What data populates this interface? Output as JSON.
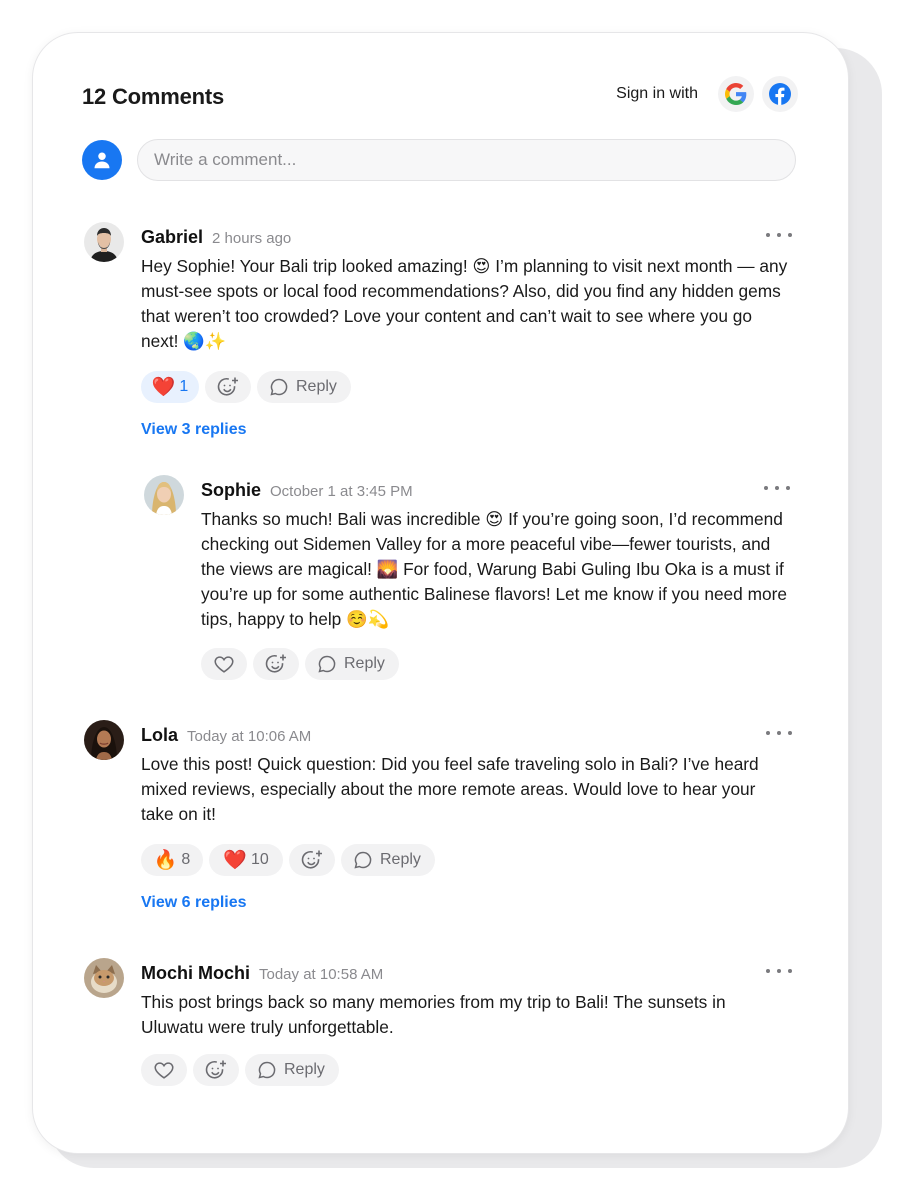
{
  "header": {
    "title": "12 Comments",
    "signin_label": "Sign in with"
  },
  "composer": {
    "placeholder": "Write a comment..."
  },
  "comments": [
    {
      "name": "Gabriel",
      "time": "2 hours ago",
      "text": "Hey Sophie! Your Bali trip looked amazing! 😍 I’m planning to visit next month — any must-see spots or local food recommendations? Also, did you find any hidden gems that weren’t too crowded? Love your content and can’t wait to see where you go next! 🌏✨",
      "reactions": [
        {
          "emoji": "❤️",
          "count": "1"
        }
      ],
      "reply_label": "Reply",
      "view_replies": "View 3 replies"
    },
    {
      "name": "Sophie",
      "time": "October 1 at 3:45 PM",
      "text": "Thanks so much! Bali was incredible 😍 If you’re going soon, I’d recommend checking out Sidemen Valley for a more peaceful vibe—fewer tourists, and the views are magical! 🌄 For food, Warung Babi Guling Ibu Oka is a must if you’re up for some authentic Balinese flavors! Let me know if you need more tips, happy to help ☺️💫",
      "reply_label": "Reply"
    },
    {
      "name": "Lola",
      "time": "Today at 10:06 AM",
      "text": "Love this post! Quick question: Did you feel safe traveling solo in Bali? I’ve heard mixed reviews, especially about the more remote areas. Would love to hear your take on it!",
      "reactions": [
        {
          "emoji": "🔥",
          "count": "8"
        },
        {
          "emoji": "❤️",
          "count": "10"
        }
      ],
      "reply_label": "Reply",
      "view_replies": "View 6 replies"
    },
    {
      "name": "Mochi Mochi",
      "time": "Today at 10:58 AM",
      "text": "This post brings back so many memories from my trip to Bali! The sunsets in Uluwatu were truly unforgettable.",
      "reply_label": "Reply"
    }
  ],
  "colors": {
    "accent": "#1877f2",
    "muted": "#8a8a8e",
    "pill": "#f2f2f3"
  },
  "icons": [
    "google-icon",
    "facebook-icon",
    "user-icon",
    "more-icon",
    "heart-icon",
    "add-reaction-icon",
    "reply-bubble-icon"
  ]
}
